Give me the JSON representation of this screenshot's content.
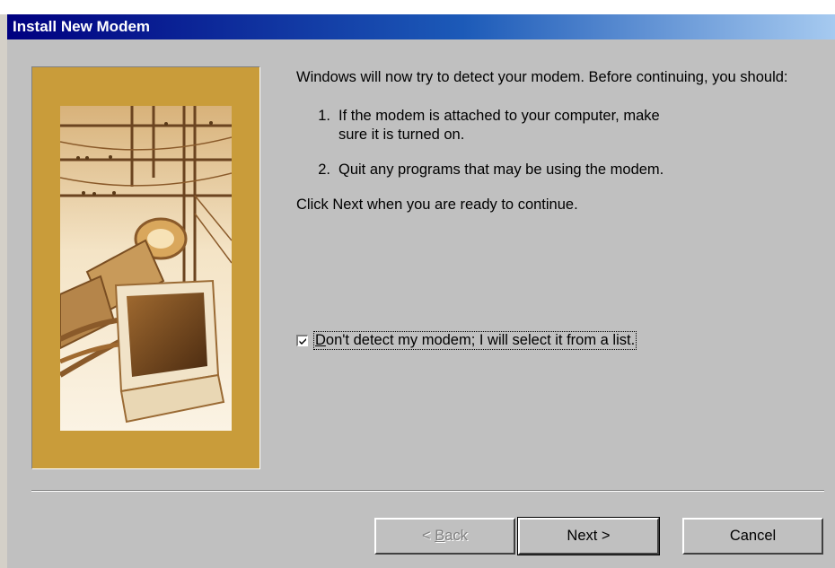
{
  "window": {
    "title": "Install New Modem"
  },
  "content": {
    "intro": "Windows will now try to detect your modem.  Before continuing, you should:",
    "steps": [
      {
        "num": "1.",
        "text": "If the modem is attached to your computer, make sure it is turned on."
      },
      {
        "num": "2.",
        "text": "Quit any programs that may be using the modem."
      }
    ],
    "instruction": "Click Next when you are ready to continue."
  },
  "checkbox": {
    "label_first": "D",
    "label_rest": "on't detect my modem; I will select it from a list.",
    "checked": true
  },
  "buttons": {
    "back_prefix": "< ",
    "back_accel": "B",
    "back_rest": "ack",
    "next": "Next >",
    "cancel": "Cancel"
  },
  "colors": {
    "title_start": "#000080",
    "title_end": "#a6caf0",
    "face": "#c0c0c0",
    "art_frame": "#c99c3a"
  },
  "icons": {
    "wizard_art": "modem-wizard-illustration",
    "checkbox_mark": "check-icon"
  }
}
